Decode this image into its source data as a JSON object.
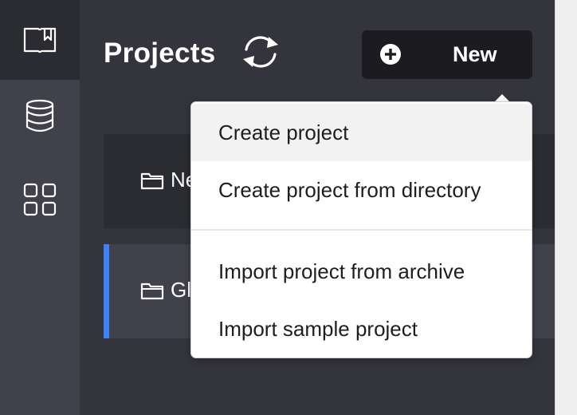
{
  "sidebar": {
    "items": [
      {
        "icon": "book-bookmark-icon",
        "active": true
      },
      {
        "icon": "database-icon",
        "active": false
      },
      {
        "icon": "grid-apps-icon",
        "active": false
      }
    ]
  },
  "header": {
    "title": "Projects",
    "sync_icon": "sync-icon",
    "new_button": {
      "icon": "plus-circle-icon",
      "label": "New"
    }
  },
  "projects": [
    {
      "icon": "folder-icon",
      "name": "Ne",
      "selected": false
    },
    {
      "icon": "folder-icon",
      "name": "Gl",
      "selected": true
    }
  ],
  "new_menu": {
    "items": [
      {
        "label": "Create project",
        "hovered": true
      },
      {
        "label": "Create project from directory",
        "hovered": false
      },
      {
        "label": "Import project from archive",
        "hovered": false
      },
      {
        "label": "Import sample project",
        "hovered": false
      }
    ]
  },
  "colors": {
    "rail": "#40414a",
    "rail_active": "#2b2c31",
    "panel": "#34353c",
    "button": "#1c1c20",
    "accent": "#3b82f6"
  }
}
